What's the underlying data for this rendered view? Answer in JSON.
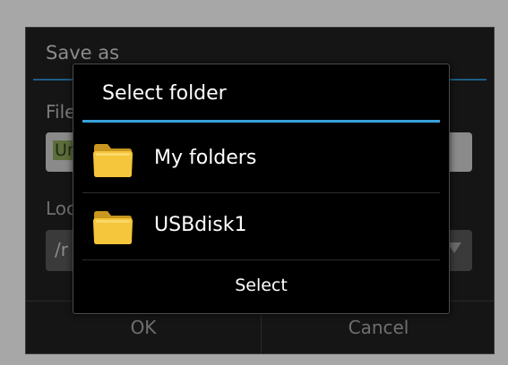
{
  "save_dialog": {
    "title": "Save as",
    "file_label": "File",
    "file_value": "Un",
    "location_label": "Loc",
    "location_value": "/r",
    "ok_label": "OK",
    "cancel_label": "Cancel"
  },
  "folder_dialog": {
    "title": "Select folder",
    "items": [
      {
        "label": "My folders",
        "icon": "folder-icon"
      },
      {
        "label": "USBdisk1",
        "icon": "folder-icon"
      }
    ],
    "select_label": "Select"
  },
  "colors": {
    "accent": "#3aa2dc",
    "folder_yellow": "#f3c33a",
    "background": "#000000"
  }
}
